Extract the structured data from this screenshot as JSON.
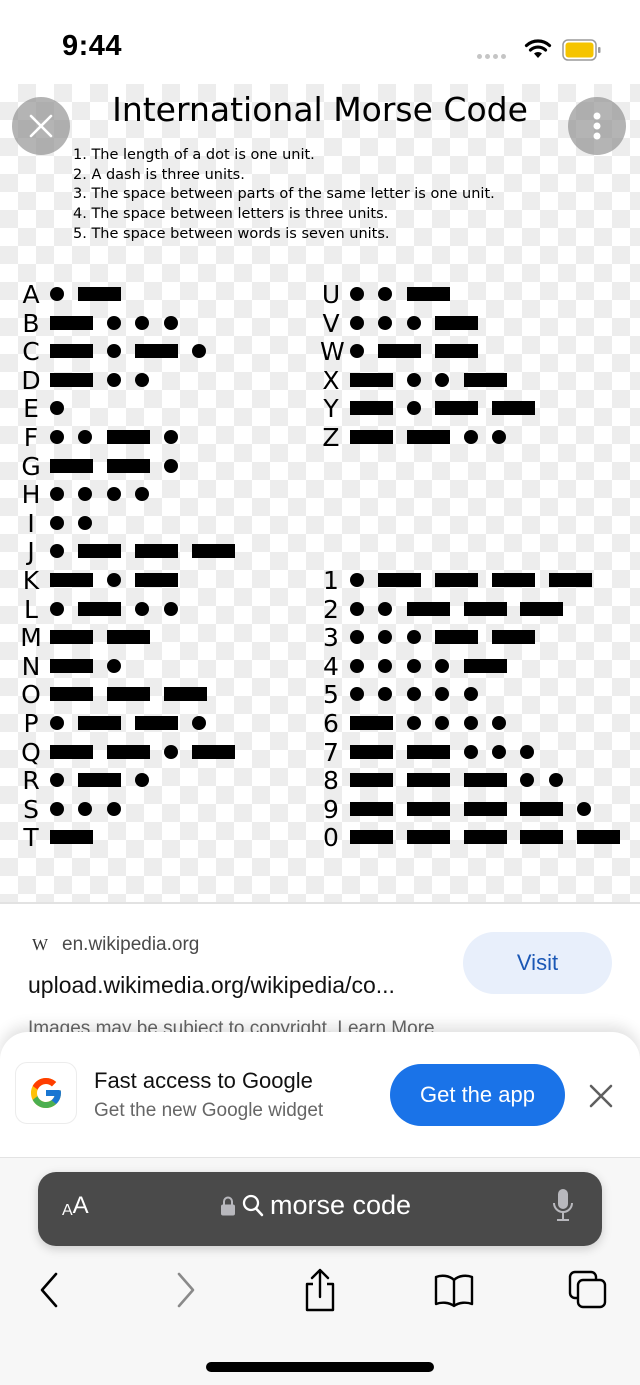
{
  "status_bar": {
    "time": "9:44",
    "icons": [
      "signal-dots-icon",
      "wifi-icon",
      "battery-icon"
    ],
    "battery_color": "#f5c400"
  },
  "viewer": {
    "close_icon": "close-icon",
    "more_icon": "more-vertical-icon",
    "image": {
      "title": "International Morse Code",
      "rules": [
        "1. The length of a dot is one unit.",
        "2. A dash is three units.",
        "3. The space between parts of the same letter is one unit.",
        "4. The space between letters is three units.",
        "5. The space between words is seven units."
      ],
      "letters": [
        {
          "char": "A",
          "code": ".-"
        },
        {
          "char": "B",
          "code": "-..."
        },
        {
          "char": "C",
          "code": "-.-."
        },
        {
          "char": "D",
          "code": "-.."
        },
        {
          "char": "E",
          "code": "."
        },
        {
          "char": "F",
          "code": "..-."
        },
        {
          "char": "G",
          "code": "--."
        },
        {
          "char": "H",
          "code": "...."
        },
        {
          "char": "I",
          "code": ".."
        },
        {
          "char": "J",
          "code": ".---"
        },
        {
          "char": "K",
          "code": "-.-"
        },
        {
          "char": "L",
          "code": ".-.."
        },
        {
          "char": "M",
          "code": "--"
        },
        {
          "char": "N",
          "code": "-."
        },
        {
          "char": "O",
          "code": "---"
        },
        {
          "char": "P",
          "code": ".--."
        },
        {
          "char": "Q",
          "code": "--.-"
        },
        {
          "char": "R",
          "code": ".-."
        },
        {
          "char": "S",
          "code": "..."
        },
        {
          "char": "T",
          "code": "-"
        }
      ],
      "letters_right": [
        {
          "char": "U",
          "code": "..-"
        },
        {
          "char": "V",
          "code": "...-"
        },
        {
          "char": "W",
          "code": ".--"
        },
        {
          "char": "X",
          "code": "-..-"
        },
        {
          "char": "Y",
          "code": "-.--"
        },
        {
          "char": "Z",
          "code": "--.."
        }
      ],
      "digits": [
        {
          "char": "1",
          "code": ".----"
        },
        {
          "char": "2",
          "code": "..---"
        },
        {
          "char": "3",
          "code": "...--"
        },
        {
          "char": "4",
          "code": "....-"
        },
        {
          "char": "5",
          "code": "....."
        },
        {
          "char": "6",
          "code": "-...."
        },
        {
          "char": "7",
          "code": "--..."
        },
        {
          "char": "8",
          "code": "---.."
        },
        {
          "char": "9",
          "code": "----."
        },
        {
          "char": "0",
          "code": "-----"
        }
      ]
    }
  },
  "result": {
    "source_icon": "W",
    "source_domain": "en.wikipedia.org",
    "url": "upload.wikimedia.org/wikipedia/co...",
    "visit_label": "Visit",
    "copyright_note": "Images may be subject to copyright. Learn More"
  },
  "promo": {
    "logo_icon": "google-g-icon",
    "title": "Fast access to Google",
    "subtitle": "Get the new Google widget",
    "cta_label": "Get the app",
    "cta_color": "#1a73e8"
  },
  "browser": {
    "text_size_small": "A",
    "text_size_large": "A",
    "address_text": "morse code",
    "toolbar_icons": [
      "back-icon",
      "forward-icon",
      "share-icon",
      "bookmarks-icon",
      "tabs-icon"
    ]
  }
}
